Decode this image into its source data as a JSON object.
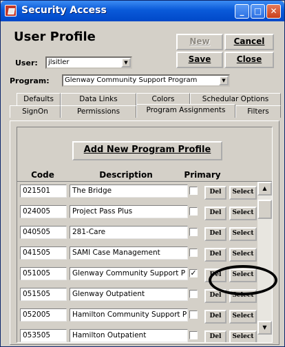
{
  "window": {
    "title": "Security Access",
    "min": "_",
    "max": "□",
    "close": "✕"
  },
  "header": {
    "title": "User Profile"
  },
  "toolbar": {
    "new": "New",
    "cancel": "Cancel",
    "save": "Save",
    "close": "Close"
  },
  "user": {
    "label": "User:",
    "value": "jlsitler"
  },
  "program": {
    "label": "Program:",
    "value": "Glenway Community Support Program"
  },
  "tabs": {
    "row1": [
      "Defaults",
      "Data Links",
      "Colors",
      "Schedular Options"
    ],
    "row2": [
      "SignOn",
      "Permissions",
      "Program Assignments",
      "Filters"
    ],
    "active": "Program Assignments"
  },
  "panel": {
    "add_button": "Add New Program Profile",
    "columns": [
      "Code",
      "Description",
      "Primary"
    ],
    "del_label": "Del",
    "select_label": "Select",
    "rows": [
      {
        "code": "021501",
        "description": "The Bridge",
        "primary": false
      },
      {
        "code": "024005",
        "description": "Project Pass Plus",
        "primary": false
      },
      {
        "code": "040505",
        "description": "281-Care",
        "primary": false
      },
      {
        "code": "041505",
        "description": "SAMI Case Management",
        "primary": false
      },
      {
        "code": "051005",
        "description": "Glenway Community Support P",
        "primary": true
      },
      {
        "code": "051505",
        "description": "Glenway Outpatient",
        "primary": false
      },
      {
        "code": "052005",
        "description": "Hamilton Community Support P",
        "primary": false
      },
      {
        "code": "053505",
        "description": "Hamilton Outpatient",
        "primary": false
      }
    ]
  },
  "scrollbar": {
    "up": "▲",
    "down": "▼"
  }
}
